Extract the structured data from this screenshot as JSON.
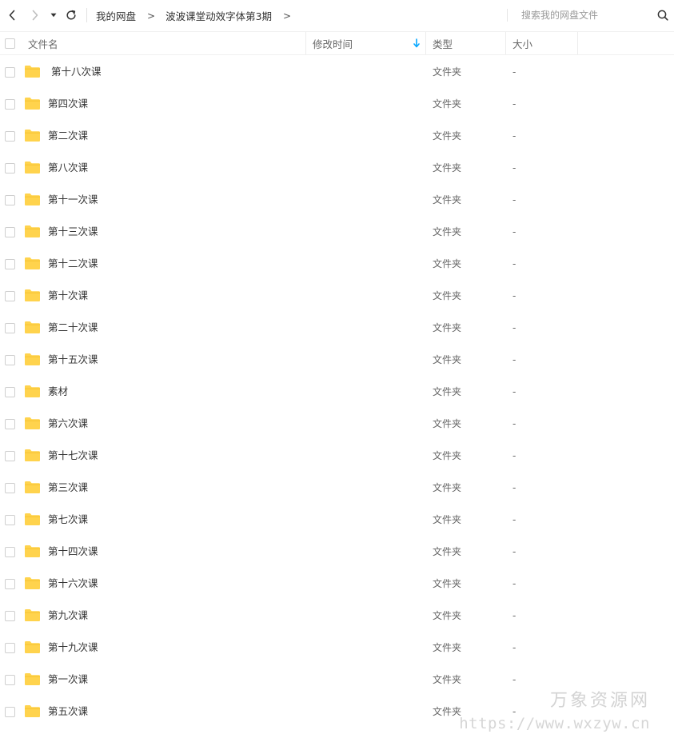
{
  "toolbar": {
    "breadcrumbs": [
      "我的网盘",
      "波波课堂动效字体第3期"
    ],
    "crumb_separator": ">",
    "search_placeholder": "搜索我的网盘文件"
  },
  "header": {
    "name": "文件名",
    "modified": "修改时间",
    "type": "类型",
    "size": "大小",
    "sort_column": "modified",
    "sort_direction": "descending"
  },
  "colors": {
    "folder": "#ffd34d",
    "sort_arrow": "#06a7ff"
  },
  "files": [
    {
      "name": " 第十八次课",
      "modified": "",
      "type": "文件夹",
      "size": "-",
      "icon": "folder-icon"
    },
    {
      "name": "第四次课",
      "modified": "",
      "type": "文件夹",
      "size": "-",
      "icon": "folder-icon"
    },
    {
      "name": "第二次课",
      "modified": "",
      "type": "文件夹",
      "size": "-",
      "icon": "folder-icon"
    },
    {
      "name": "第八次课",
      "modified": "",
      "type": "文件夹",
      "size": "-",
      "icon": "folder-icon"
    },
    {
      "name": "第十一次课",
      "modified": "",
      "type": "文件夹",
      "size": "-",
      "icon": "folder-icon"
    },
    {
      "name": "第十三次课",
      "modified": "",
      "type": "文件夹",
      "size": "-",
      "icon": "folder-icon"
    },
    {
      "name": "第十二次课",
      "modified": "",
      "type": "文件夹",
      "size": "-",
      "icon": "folder-icon"
    },
    {
      "name": "第十次课",
      "modified": "",
      "type": "文件夹",
      "size": "-",
      "icon": "folder-icon"
    },
    {
      "name": "第二十次课",
      "modified": "",
      "type": "文件夹",
      "size": "-",
      "icon": "folder-icon"
    },
    {
      "name": "第十五次课",
      "modified": "",
      "type": "文件夹",
      "size": "-",
      "icon": "folder-icon"
    },
    {
      "name": "素材",
      "modified": "",
      "type": "文件夹",
      "size": "-",
      "icon": "folder-icon"
    },
    {
      "name": "第六次课",
      "modified": "",
      "type": "文件夹",
      "size": "-",
      "icon": "folder-icon"
    },
    {
      "name": "第十七次课",
      "modified": "",
      "type": "文件夹",
      "size": "-",
      "icon": "folder-icon"
    },
    {
      "name": "第三次课",
      "modified": "",
      "type": "文件夹",
      "size": "-",
      "icon": "folder-icon"
    },
    {
      "name": "第七次课",
      "modified": "",
      "type": "文件夹",
      "size": "-",
      "icon": "folder-icon"
    },
    {
      "name": "第十四次课",
      "modified": "",
      "type": "文件夹",
      "size": "-",
      "icon": "folder-icon"
    },
    {
      "name": "第十六次课",
      "modified": "",
      "type": "文件夹",
      "size": "-",
      "icon": "folder-icon"
    },
    {
      "name": "第九次课",
      "modified": "",
      "type": "文件夹",
      "size": "-",
      "icon": "folder-icon"
    },
    {
      "name": "第十九次课",
      "modified": "",
      "type": "文件夹",
      "size": "-",
      "icon": "folder-icon"
    },
    {
      "name": "第一次课",
      "modified": "",
      "type": "文件夹",
      "size": "-",
      "icon": "folder-icon"
    },
    {
      "name": "第五次课",
      "modified": "",
      "type": "文件夹",
      "size": "-",
      "icon": "folder-icon"
    }
  ],
  "watermark": {
    "title": "万象资源网",
    "url": "https://www.wxzyw.cn"
  }
}
